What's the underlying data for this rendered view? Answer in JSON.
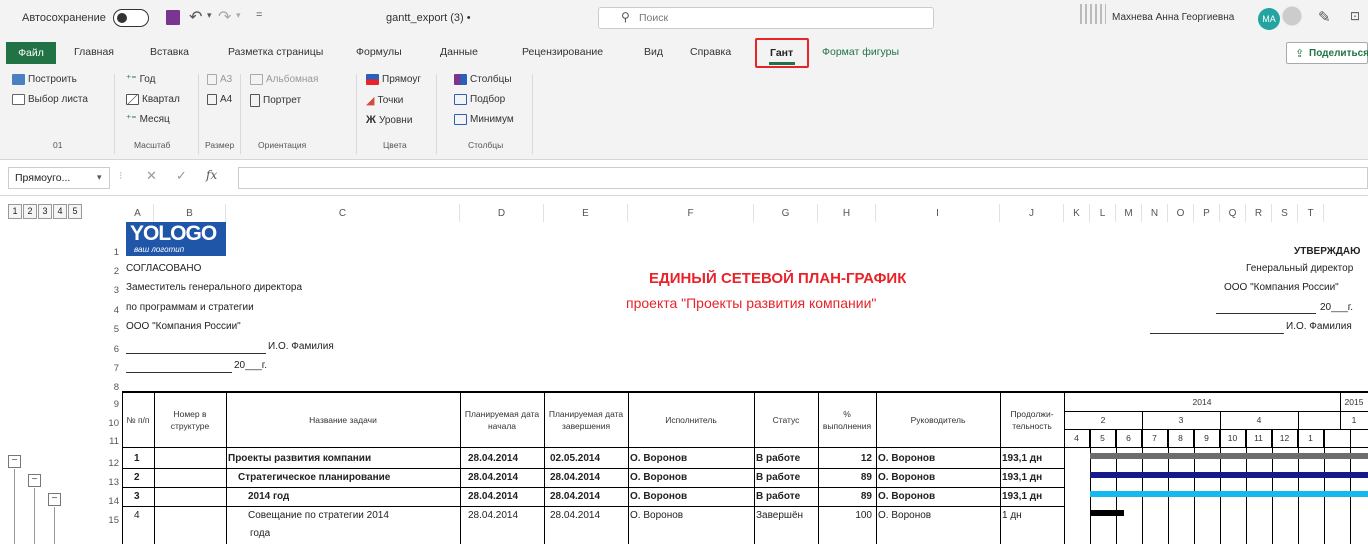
{
  "titlebar": {
    "autosave_label": "Автосохранение",
    "filename": "gantt_export (3) •",
    "search_placeholder": "Поиск",
    "user_name": "Махнева Анна Георгиевна",
    "user_initials": "МА"
  },
  "menu": {
    "file": "Файл",
    "tabs": [
      "Главная",
      "Вставка",
      "Разметка страницы",
      "Формулы",
      "Данные",
      "Рецензирование",
      "Вид",
      "Справка",
      "Гант",
      "Формат фигуры"
    ],
    "share": "Поделиться"
  },
  "ribbon": {
    "group01": {
      "build": "Построить",
      "select_sheet": "Выбор листа",
      "label": "01"
    },
    "scale": {
      "year": "Год",
      "quarter": "Квартал",
      "month": "Месяц",
      "label": "Масштаб"
    },
    "size": {
      "a3": "A3",
      "a4": "A4",
      "label": "Размер"
    },
    "orientation": {
      "landscape": "Альбомная",
      "portrait": "Портрет",
      "label": "Ориентация"
    },
    "colors": {
      "rect": "Прямоуг",
      "points": "Точки",
      "levels": "Уровни",
      "label": "Цвета"
    },
    "columns": {
      "cols": "Столбцы",
      "fit": "Подбор",
      "min": "Минимум",
      "label": "Столбцы"
    }
  },
  "formula": {
    "namebox": "Прямоуго...",
    "fx": "fx"
  },
  "outline_levels": [
    "1",
    "2",
    "3",
    "4",
    "5"
  ],
  "columns": [
    "A",
    "B",
    "C",
    "D",
    "E",
    "F",
    "G",
    "H",
    "I",
    "J",
    "K",
    "L",
    "M",
    "N",
    "O",
    "P",
    "Q",
    "R",
    "S",
    "T"
  ],
  "rows": [
    "1",
    "2",
    "3",
    "4",
    "5",
    "6",
    "7",
    "8",
    "9",
    "10",
    "11",
    "12",
    "13",
    "14",
    "15"
  ],
  "logo": {
    "main": "YOLOGO",
    "sub": "ваш логотип"
  },
  "header_left": {
    "l2": "СОГЛАСОВАНО",
    "l3": "Заместитель генерального директора",
    "l4": "по программам и стратегии",
    "l5": "ООО \"Компания России\"",
    "l6": "И.О. Фамилия",
    "l7": "20___г."
  },
  "center_title": {
    "title": "ЕДИНЫЙ СЕТЕВОЙ ПЛАН-ГРАФИК",
    "subtitle": "проекта \"Проекты развития компании\""
  },
  "header_right": {
    "l1": "УТВЕРЖДАЮ",
    "l2": "Генеральный директор",
    "l3": "ООО \"Компания России\"",
    "l4": "20___г.",
    "l5": "И.О. Фамилия"
  },
  "table_headers": {
    "num": "№ п/п",
    "struct": "Номер в структуре",
    "task": "Название задачи",
    "start": "Планируемая дата начала",
    "end": "Планируемая дата завершения",
    "executor": "Исполнитель",
    "status": "Статус",
    "percent": "% выполнения",
    "manager": "Руководитель",
    "duration": "Продолжи-тельность",
    "year1": "2014",
    "year2": "2015",
    "quarters": [
      "2",
      "3",
      "4",
      "1"
    ],
    "months": [
      "4",
      "5",
      "6",
      "7",
      "8",
      "9",
      "10",
      "11",
      "12",
      "1"
    ]
  },
  "tasks": [
    {
      "num": "1",
      "task": "Проекты развития компании",
      "start": "28.04.2014",
      "end": "02.05.2014",
      "executor": "О. Воронов",
      "status": "В работе",
      "percent": "12",
      "manager": "О. Воронов",
      "duration": "193,1 дн"
    },
    {
      "num": "2",
      "task": "Стратегическое планирование",
      "start": "28.04.2014",
      "end": "28.04.2014",
      "executor": "О. Воронов",
      "status": "В работе",
      "percent": "89",
      "manager": "О. Воронов",
      "duration": "193,1 дн"
    },
    {
      "num": "3",
      "task": "2014 год",
      "start": "28.04.2014",
      "end": "28.04.2014",
      "executor": "О. Воронов",
      "status": "В работе",
      "percent": "89",
      "manager": "О. Воронов",
      "duration": "193,1 дн"
    },
    {
      "num": "4",
      "task": "Совещание по стратегии 2014",
      "task2": "года",
      "start": "28.04.2014",
      "end": "28.04.2014",
      "executor": "О. Воронов",
      "status": "Завершён",
      "percent": "100",
      "manager": "О. Воронов",
      "duration": "1 дн"
    }
  ],
  "colors": {
    "excel_green": "#217346",
    "highlight": "#e8232a",
    "title_red": "#e8232a",
    "bar_gray": "#6d6d6d",
    "bar_navy": "#141a8c",
    "bar_cyan": "#16b8f0",
    "bar_black": "#000000",
    "logo_blue": "#1f56a8"
  }
}
